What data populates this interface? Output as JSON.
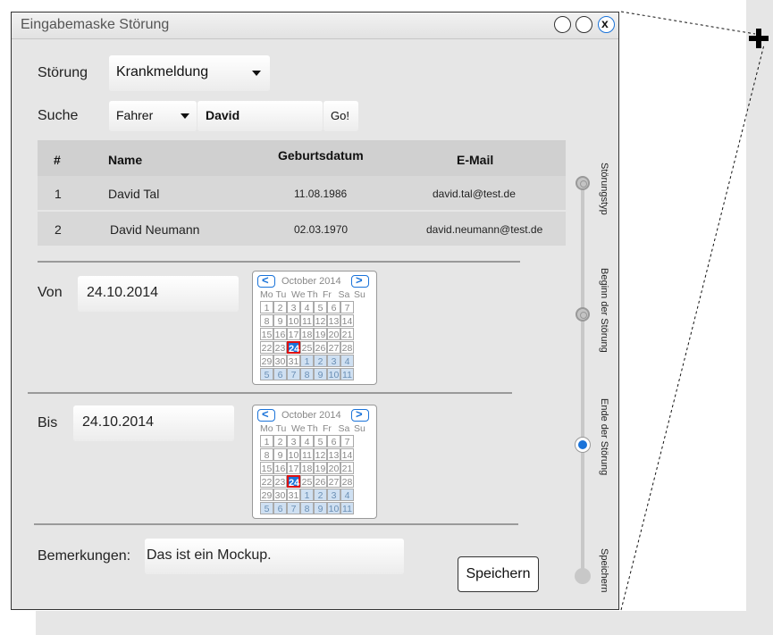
{
  "window": {
    "title": "Eingabemaske Störung",
    "close_glyph": "x"
  },
  "stoerung": {
    "label": "Störung",
    "value": "Krankmeldung"
  },
  "suche": {
    "label": "Suche",
    "filter": "Fahrer",
    "query": "David",
    "go": "Go!"
  },
  "table": {
    "headers": [
      "#",
      "Name",
      "Geburtsdatum",
      "E-Mail"
    ],
    "rows": [
      [
        "1",
        "David Tal",
        "11.08.1986",
        "david.tal@test.de"
      ],
      [
        "2",
        "David Neumann",
        "02.03.1970",
        "david.neumann@test.de"
      ]
    ]
  },
  "von": {
    "label": "Von",
    "value": "24.10.2014"
  },
  "bis": {
    "label": "Bis",
    "value": "24.10.2014"
  },
  "calendar": {
    "month": "October 2014",
    "prev": "<",
    "next": ">",
    "weekdays": [
      "Mo",
      "Tu",
      "We",
      "Th",
      "Fr",
      "Sa",
      "Su"
    ],
    "days": [
      "1",
      "2",
      "3",
      "4",
      "5",
      "6",
      "7",
      "8",
      "9",
      "10",
      "11",
      "12",
      "13",
      "14",
      "15",
      "16",
      "17",
      "18",
      "19",
      "20",
      "21",
      "22",
      "23",
      "24",
      "25",
      "26",
      "27",
      "28",
      "29",
      "30",
      "31"
    ],
    "next_month_days": [
      "1",
      "2",
      "3",
      "4",
      "5",
      "6",
      "7",
      "8",
      "9",
      "10",
      "11"
    ],
    "selected": "24"
  },
  "bemerkungen": {
    "label": "Bemerkungen:",
    "value": "Das ist ein Mockup."
  },
  "save_label": "Speichern",
  "wizard": {
    "steps": [
      "Störungstyp",
      "Beginn der Störung",
      "Ende der Störung",
      "Speichern"
    ],
    "current_step": 3
  },
  "colors": {
    "accent": "#1a73d9",
    "today_border": "#dd1111"
  }
}
